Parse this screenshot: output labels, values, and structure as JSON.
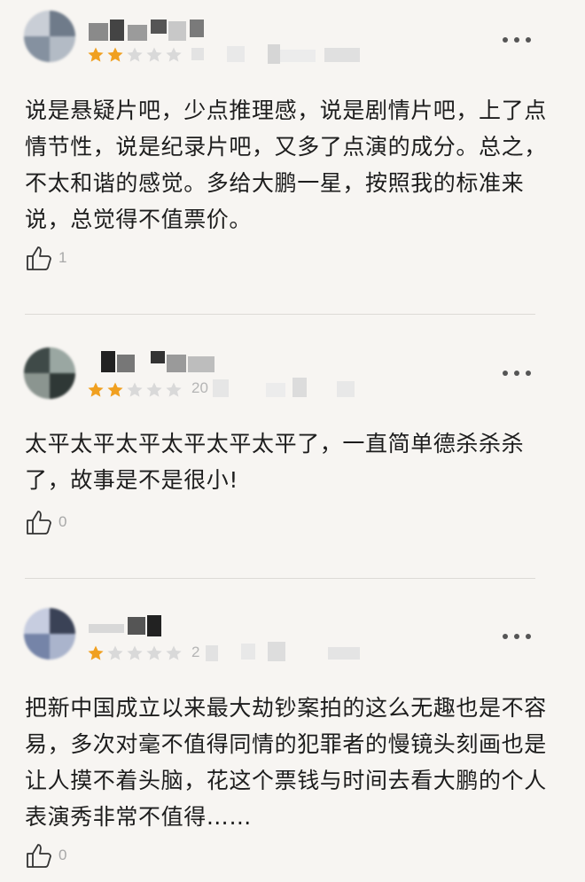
{
  "reviews": [
    {
      "rating": 2,
      "date_fragment": "",
      "text": "说是悬疑片吧，少点推理感，说是剧情片吧，上了点情节性，说是纪录片吧，又多了点演的成分。总之，不太和谐的感觉。多给大鹏一星，按照我的标准来说，总觉得不值票价。",
      "likes": "1"
    },
    {
      "rating": 2,
      "date_fragment": "20",
      "text": "太平太平太平太平太平太平了，一直简单德杀杀杀了，故事是不是很小!",
      "likes": "0"
    },
    {
      "rating": 1,
      "date_fragment": "2",
      "text": "把新中国成立以来最大劫钞案拍的这么无趣也是不容易，多次对毫不值得同情的犯罪者的慢镜头刻画也是让人摸不着头脑，花这个票钱与时间去看大鹏的个人表演秀非常不值得……",
      "likes": "0"
    }
  ],
  "colors": {
    "star_filled": "#f0a020",
    "star_empty": "#d9d9d9",
    "text": "#1d1d1d",
    "muted": "#a8a8a8",
    "background": "#f7f5f2"
  },
  "icons": {
    "more": "more-dots-icon",
    "like": "thumbs-up-icon",
    "star": "star-icon"
  }
}
